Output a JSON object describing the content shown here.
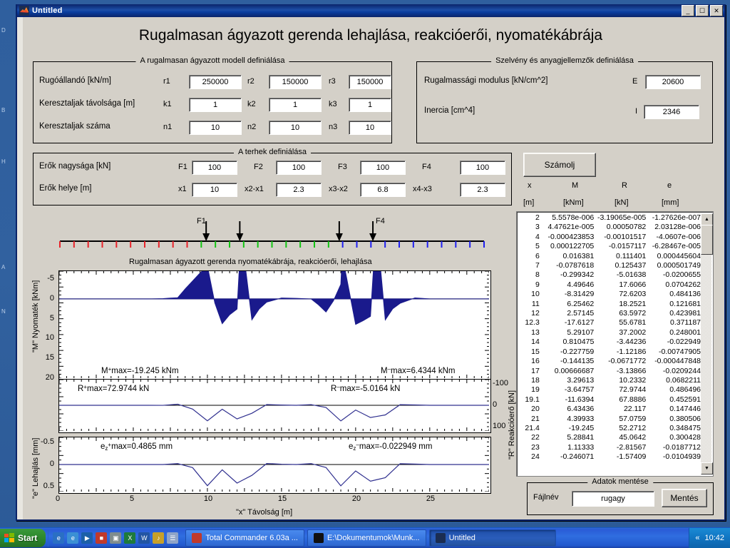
{
  "desktop": {
    "icons": [
      "D",
      "B",
      "H",
      "A",
      "N"
    ]
  },
  "window": {
    "title": "Untitled",
    "icon": "matlab-icon",
    "minimize": "_",
    "maximize": "☐",
    "close": "✕"
  },
  "app_title": "Rugalmasan ágyazott gerenda lehajlása, reakcióerői, nyomatékábrája",
  "model_panel": {
    "title": "A rugalmasan ágyazott modell definiálása",
    "rows": [
      {
        "label": "Rugóállandó [kN/m]",
        "fields": [
          {
            "name": "r1",
            "value": "250000"
          },
          {
            "name": "r2",
            "value": "150000"
          },
          {
            "name": "r3",
            "value": "150000"
          }
        ]
      },
      {
        "label": "Keresztaljak távolsága [m]",
        "fields": [
          {
            "name": "k1",
            "value": "1"
          },
          {
            "name": "k2",
            "value": "1"
          },
          {
            "name": "k3",
            "value": "1"
          }
        ]
      },
      {
        "label": "Keresztaljak száma",
        "fields": [
          {
            "name": "n1",
            "value": "10"
          },
          {
            "name": "n2",
            "value": "10"
          },
          {
            "name": "n3",
            "value": "10"
          }
        ]
      }
    ]
  },
  "section_panel": {
    "title": "Szelvény és anyagjellemzők definiálása",
    "rows": [
      {
        "label": "Rugalmassági modulus [kN/cm^2]",
        "name": "E",
        "value": "20600"
      },
      {
        "label": "Inercia [cm^4]",
        "name": "I",
        "value": "2346"
      }
    ]
  },
  "loads_panel": {
    "title": "A terhek definiálása",
    "rows": [
      {
        "label": "Erők nagysága [kN]",
        "fields": [
          {
            "name": "F1",
            "value": "100"
          },
          {
            "name": "F2",
            "value": "100"
          },
          {
            "name": "F3",
            "value": "100"
          },
          {
            "name": "F4",
            "value": "100"
          }
        ]
      },
      {
        "label": "Erők helye [m]",
        "fields": [
          {
            "name": "x1",
            "value": "10"
          },
          {
            "name": "x2-x1",
            "value": "2.3"
          },
          {
            "name": "x3-x2",
            "value": "6.8"
          },
          {
            "name": "x4-x3",
            "value": "2.3"
          }
        ]
      }
    ]
  },
  "compute_button": "Számolj",
  "results_table": {
    "headers": [
      "x",
      "M",
      "R",
      "e"
    ],
    "units": [
      "[m]",
      "[kNm]",
      "[kN]",
      "[mm]"
    ],
    "rows": [
      [
        "2",
        "5.5578e-006",
        "-3.19065e-005",
        "-1.27626e-007"
      ],
      [
        "3",
        "4.47621e-005",
        "0.00050782",
        "2.03128e-006"
      ],
      [
        "4",
        "-0.000423853",
        "-0.00101517",
        "-4.0607e-006"
      ],
      [
        "5",
        "0.000122705",
        "-0.0157117",
        "-6.28467e-005"
      ],
      [
        "6",
        "0.016381",
        "0.111401",
        "0.000445604"
      ],
      [
        "7",
        "-0.0787618",
        "0.125437",
        "0.000501749"
      ],
      [
        "8",
        "-0.299342",
        "-5.01638",
        "-0.0200655"
      ],
      [
        "9",
        "4.49646",
        "17.6066",
        "0.0704262"
      ],
      [
        "10",
        "-8.31429",
        "72.6203",
        "0.484136"
      ],
      [
        "11",
        "6.25462",
        "18.2521",
        "0.121681"
      ],
      [
        "12",
        "2.57145",
        "63.5972",
        "0.423981"
      ],
      [
        "12.3",
        "-17.6127",
        "55.6781",
        "0.371187"
      ],
      [
        "13",
        "5.29107",
        "37.2002",
        "0.248001"
      ],
      [
        "14",
        "0.810475",
        "-3.44236",
        "-0.022949"
      ],
      [
        "15",
        "-0.227759",
        "-1.12186",
        "-0.00747905"
      ],
      [
        "16",
        "-0.144135",
        "-0.0671772",
        "-0.000447848"
      ],
      [
        "17",
        "0.00666687",
        "-3.13866",
        "-0.0209244"
      ],
      [
        "18",
        "3.29613",
        "10.2332",
        "0.0682211"
      ],
      [
        "19",
        "-3.64757",
        "72.9744",
        "0.486496"
      ],
      [
        "19.1",
        "-11.6394",
        "67.8886",
        "0.452591"
      ],
      [
        "20",
        "6.43436",
        "22.117",
        "0.147446"
      ],
      [
        "21",
        "4.39933",
        "57.0759",
        "0.380506"
      ],
      [
        "21.4",
        "-19.245",
        "52.2712",
        "0.348475"
      ],
      [
        "22",
        "5.28841",
        "45.0642",
        "0.300428"
      ],
      [
        "23",
        "1.11333",
        "-2.81567",
        "-0.0187712"
      ],
      [
        "24",
        "-0.246071",
        "-1.57409",
        "-0.0104939"
      ]
    ]
  },
  "save_panel": {
    "title": "Adatok mentése",
    "filename_label": "Fájlnév",
    "filename_value": "rugagy",
    "save_button": "Mentés"
  },
  "beam": {
    "force_labels": [
      "F1",
      "F4"
    ],
    "force_positions_m": [
      10,
      12.3,
      19.1,
      21.4
    ],
    "segment_colors": [
      "#e8232a",
      "#13c413",
      "#2020ef"
    ],
    "x_range_m": [
      0,
      29
    ]
  },
  "chart_data": [
    {
      "type": "area",
      "title": "Rugalmasan ágyazott gerenda nyomatékábrája, reakcióerői, lehajlása",
      "ylabel": "\"M\"  Nyomaték [kNm]",
      "xlabel": "",
      "ylim": [
        -7,
        20
      ],
      "yticks": [
        -5,
        0,
        5,
        10,
        15,
        20
      ],
      "ytick_labels": [
        "-5",
        "0",
        "5",
        "10",
        "15",
        "20"
      ],
      "y_inverted": true,
      "xlim": [
        0,
        29
      ],
      "series_color": "#1a1a8c",
      "annotations": [
        {
          "text": "M⁺max=-19.245 kNm",
          "x": 6.5,
          "y": 18
        },
        {
          "text": "M⁻max=6.4344 kNm",
          "x": 20.0,
          "y": 18
        }
      ],
      "x": [
        0,
        1,
        2,
        3,
        4,
        5,
        6,
        7,
        7.5,
        8,
        8.5,
        9,
        9.5,
        10,
        10.5,
        11,
        11.5,
        12,
        12.3,
        12.4,
        13,
        13.5,
        14,
        15,
        16,
        17,
        17.5,
        18,
        18.5,
        19,
        19.1,
        19.2,
        20,
        20.5,
        21,
        21.4,
        21.5,
        22,
        22.5,
        23,
        24,
        25,
        26,
        27,
        28,
        29
      ],
      "values": [
        0,
        0,
        0,
        0,
        0,
        0,
        0.02,
        -0.08,
        -0.2,
        -0.3,
        -2.5,
        -4.5,
        -6.5,
        -8.3,
        1.0,
        6.25,
        4.0,
        2.57,
        -17.6,
        -13,
        5.29,
        2.5,
        0.81,
        -0.23,
        -0.14,
        0.01,
        1.5,
        3.3,
        0.5,
        -3.65,
        -11.6,
        -9,
        6.43,
        5.5,
        4.4,
        -19.2,
        -15,
        5.29,
        2.5,
        1.11,
        -0.25,
        0,
        0,
        0,
        0,
        0
      ]
    },
    {
      "type": "line",
      "ylabel": "\"R\"  Reakcióerő [kN]",
      "ylim": [
        -120,
        120
      ],
      "yticks": [
        -100,
        0,
        100
      ],
      "ytick_labels": [
        "-100",
        "0",
        "100"
      ],
      "y_inverted": true,
      "xlim": [
        0,
        29
      ],
      "series_color": "#30308f",
      "annotations": [
        {
          "text": "R⁺max=72.9744 kN",
          "x": 6.0,
          "y": -80
        },
        {
          "text": "R⁻max=-5.0164 kN",
          "x": 18.5,
          "y": -80
        }
      ],
      "x": [
        0,
        1,
        2,
        3,
        4,
        5,
        6,
        7,
        8,
        9,
        10,
        11,
        12,
        12.3,
        13,
        14,
        15,
        16,
        17,
        18,
        19,
        19.1,
        20,
        21,
        21.4,
        22,
        23,
        24,
        25,
        26,
        27,
        28,
        29
      ],
      "values": [
        0,
        0,
        0,
        0,
        0,
        -0.02,
        0.11,
        0.13,
        -5.02,
        17.6,
        72.6,
        18.25,
        63.6,
        55.7,
        37.2,
        -3.44,
        -1.12,
        -0.07,
        -3.14,
        10.23,
        72.97,
        67.89,
        22.12,
        57.08,
        52.27,
        45.06,
        -2.82,
        -1.57,
        0,
        0,
        0,
        0,
        0
      ]
    },
    {
      "type": "line",
      "ylabel": "\"e\"  Lehajlás [mm]",
      "xlabel": "\"x\"  Távolság [m]",
      "ylim": [
        -0.62,
        0.62
      ],
      "yticks": [
        -0.5,
        0,
        0.5
      ],
      "ytick_labels": [
        "-0.5",
        "0",
        "0.5"
      ],
      "y_inverted": true,
      "xlim": [
        0,
        29
      ],
      "xticks": [
        0,
        5,
        10,
        15,
        20,
        25
      ],
      "xtick_labels": [
        "0",
        "5",
        "10",
        "15",
        "20",
        "25"
      ],
      "series_color": "#30308f",
      "annotations": [
        {
          "text": "ez⁺max=0.4865 mm",
          "x": 4.0,
          "y": -0.4
        },
        {
          "text": "ez⁻max=-0.022949 mm",
          "x": 17.0,
          "y": -0.4
        }
      ],
      "x": [
        0,
        1,
        2,
        3,
        4,
        5,
        6,
        7,
        8,
        9,
        10,
        11,
        12,
        12.3,
        13,
        14,
        15,
        16,
        17,
        18,
        19,
        19.1,
        20,
        21,
        21.4,
        22,
        23,
        24,
        25,
        26,
        27,
        28,
        29
      ],
      "values": [
        0,
        0,
        0,
        0,
        0,
        0,
        0.0004,
        0.0005,
        -0.0201,
        0.0704,
        0.4841,
        0.1217,
        0.424,
        0.3712,
        0.248,
        -0.0229,
        -0.0075,
        -0.0004,
        -0.0209,
        0.0682,
        0.4865,
        0.4526,
        0.1474,
        0.3805,
        0.3485,
        0.3004,
        -0.0188,
        -0.0105,
        0,
        0,
        0,
        0,
        0
      ]
    }
  ],
  "taskbar": {
    "start": "Start",
    "quicklaunch": [
      "ie-icon",
      "browser-icon",
      "media-icon",
      "save-icon",
      "photo-icon",
      "excel-icon",
      "word-icon",
      "winamp-icon",
      "notepad-icon"
    ],
    "tasks": [
      {
        "label": "Total Commander 6.03a ...",
        "icon": "tc-icon",
        "active": false
      },
      {
        "label": "E:\\Dokumentumok\\Munk...",
        "icon": "cmd-icon",
        "active": false
      },
      {
        "label": "Untitled",
        "icon": "matlab-icon",
        "active": true
      }
    ],
    "tray_arrow": "«",
    "clock": "10:42"
  }
}
